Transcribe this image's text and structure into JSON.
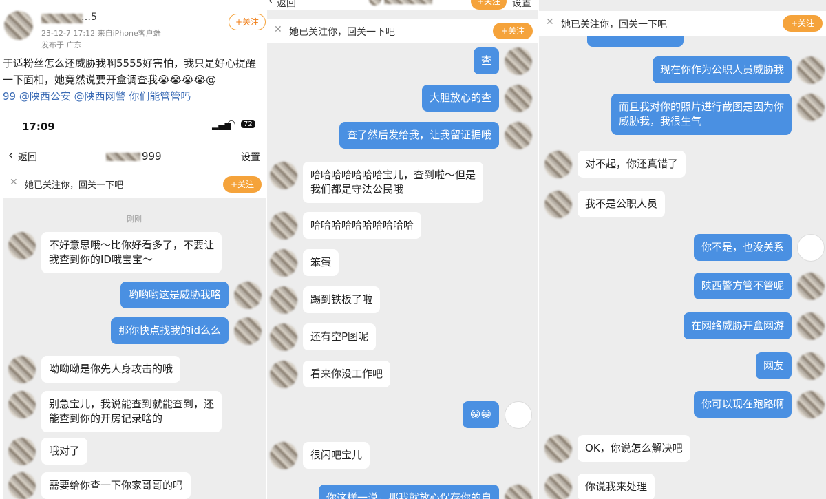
{
  "panel1": {
    "post": {
      "username": "…5",
      "meta_line": "23-12-7 17:12  来自iPhone客户端",
      "location": "发布于 广东",
      "follow_label": "+关注",
      "body_line1": "于适粉丝怎么还威胁我啊5555好害怕，我只是好心提醒",
      "body_line2": "一下面相，她竟然说要开盒调查我😭😭😭😭@",
      "body_line3": "99 @陕西公安 @陕西网警 你们能管管吗"
    },
    "status_bar": {
      "time": "17:09",
      "battery": "72"
    },
    "nav": {
      "back_label": "返回",
      "title": "999",
      "settings_label": "设置"
    },
    "notice": {
      "text": "她已关注你，回关一下吧",
      "follow_label": "+关注"
    },
    "timestamp": "刚刚",
    "messages": [
      {
        "side": "left",
        "text": "不好意思哦～比你好看多了，不要让\n我查到你的ID哦宝宝～"
      },
      {
        "side": "right",
        "text": "哟哟哟这是威胁我咯"
      },
      {
        "side": "right",
        "text": "那你快点找我的id么么"
      },
      {
        "side": "left",
        "text": "呦呦呦是你先人身攻击的哦"
      },
      {
        "side": "left",
        "text": "别急宝儿，我说能查到就能查到，还\n能查到你的开房记录啥的"
      },
      {
        "side": "left",
        "text": "哦对了"
      },
      {
        "side": "left",
        "text": "需要给你查一下你家哥哥的吗"
      }
    ]
  },
  "panel2": {
    "nav": {
      "back_label": "返回",
      "follow_label": "+关注",
      "settings_label": "设置"
    },
    "notice": {
      "text": "她已关注你，回关一下吧",
      "follow_label": "+关注"
    },
    "messages": [
      {
        "side": "right",
        "text": "查"
      },
      {
        "side": "right",
        "text": "大胆放心的查"
      },
      {
        "side": "right",
        "text": "查了然后发给我，让我留证据哦"
      },
      {
        "side": "left",
        "text": "哈哈哈哈哈哈哈宝儿，查到啦～但是\n我们都是守法公民哦"
      },
      {
        "side": "left",
        "text": "哈哈哈哈哈哈哈哈哈哈"
      },
      {
        "side": "left",
        "text": "笨蛋"
      },
      {
        "side": "left",
        "text": "踢到铁板了啦"
      },
      {
        "side": "left",
        "text": "还有空P图呢"
      },
      {
        "side": "left",
        "text": "看来你没工作吧"
      },
      {
        "side": "right",
        "text": "😁😁"
      },
      {
        "side": "left",
        "text": "很闲吧宝儿"
      },
      {
        "side": "right",
        "text": "你这样一说，那我就放心保存你的自"
      }
    ]
  },
  "panel3": {
    "notice": {
      "text": "她已关注你，回关一下吧",
      "follow_label": "+关注"
    },
    "messages": [
      {
        "side": "right",
        "text": "现在你作为公职人员威胁我"
      },
      {
        "side": "right",
        "text": "而且我对你的照片进行截图是因为你\n威胁我，我很生气"
      },
      {
        "side": "left",
        "text": "对不起，你还真错了"
      },
      {
        "side": "left",
        "text": "我不是公职人员"
      },
      {
        "side": "right",
        "text": "你不是，也没关系"
      },
      {
        "side": "right",
        "text": "陕西警方管不管呢"
      },
      {
        "side": "right",
        "text": "在网络威胁开盒网游"
      },
      {
        "side": "right",
        "text": "网友"
      },
      {
        "side": "right",
        "text": "你可以现在跑路啊"
      },
      {
        "side": "left",
        "text": "OK，你说怎么解决吧"
      },
      {
        "side": "left",
        "text": "你说我来处理"
      }
    ]
  },
  "colors": {
    "accent_orange": "#f5a33b",
    "bubble_blue": "#4a90e2",
    "chat_bg": "#ededed",
    "link_blue": "#3a6bb5"
  }
}
